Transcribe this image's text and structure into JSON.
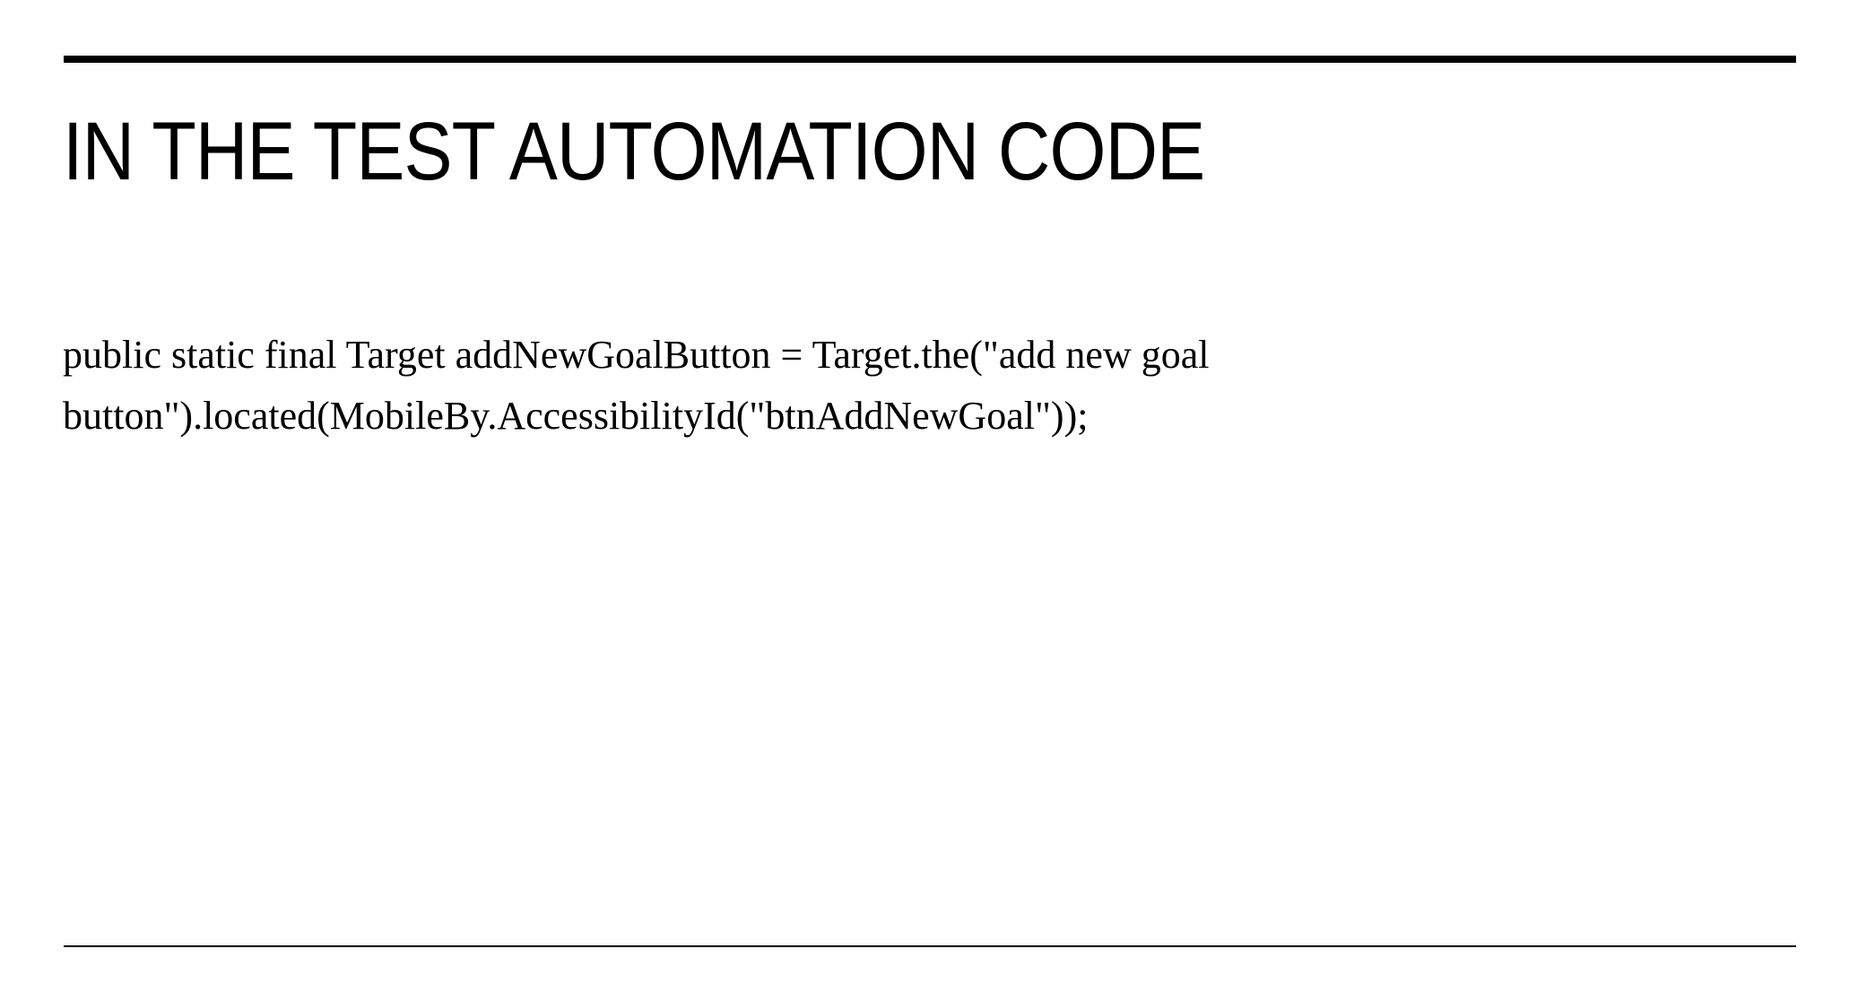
{
  "slide": {
    "title": "IN THE TEST AUTOMATION CODE",
    "code_lines": [
      "public static final Target addNewGoalButton = Target.the(\"add new goal",
      "button\").located(MobileBy.AccessibilityId(\"btnAddNewGoal\"));"
    ]
  }
}
